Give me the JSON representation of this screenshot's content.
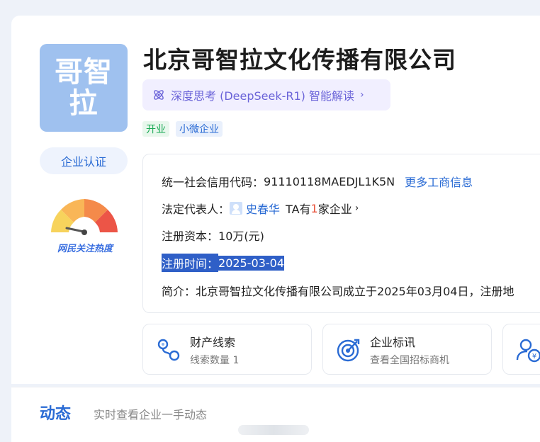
{
  "company": {
    "logo_line1": "哥智",
    "logo_line2": "拉",
    "name": "北京哥智拉文化传播有限公司",
    "ai_button_label": "深度思考 (DeepSeek-R1) 智能解读",
    "tags": [
      "开业",
      "小微企业"
    ],
    "cert_button": "企业认证",
    "heat_label": "网民关注热度"
  },
  "info": {
    "credit_code_label": "统一社会信用代码：",
    "credit_code_value": "91110118MAEDJL1K5N",
    "more_link": "更多工商信息",
    "legal_rep_label": "法定代表人：",
    "legal_rep_name": "史春华",
    "ta_has_prefix": "TA有",
    "ta_has_count": "1",
    "ta_has_suffix": "家企业",
    "capital_label": "注册资本：",
    "capital_value": "10万(元)",
    "reg_time_label": "注册时间：",
    "reg_time_value": "2025-03-04",
    "intro_label": "简介：",
    "intro_text": "北京哥智拉文化传播有限公司成立于2025年03月04日，注册地"
  },
  "features": [
    {
      "title": "财产线索",
      "subtitle": "线索数量 1",
      "icon": "link-nodes-icon"
    },
    {
      "title": "企业标讯",
      "subtitle": "查看全国招标商机",
      "icon": "target-icon"
    },
    {
      "title": "",
      "subtitle": "",
      "icon": "person-yen-icon"
    }
  ],
  "dynamics": {
    "title": "动态",
    "subtitle": "实时查看企业一手动态"
  },
  "colors": {
    "accent": "#2a6bd4",
    "logo_bg": "#9fc1ef",
    "ai_purple": "#6a63d8",
    "open_green": "#1aaa55",
    "highlight": "#2f5fc7"
  }
}
